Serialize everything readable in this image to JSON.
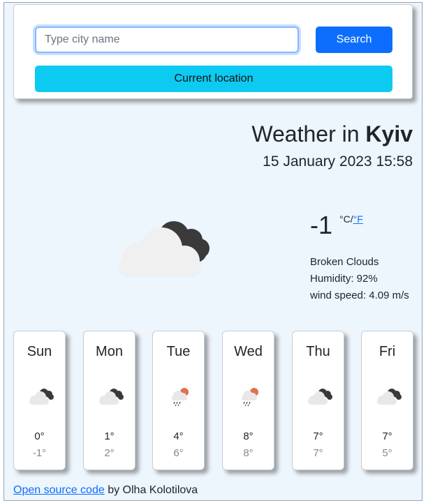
{
  "search": {
    "placeholder": "Type city name",
    "button_label": "Search",
    "location_label": "Current location"
  },
  "weather": {
    "title_prefix": "Weather in",
    "city": "Kyiv",
    "date": "15 January 2023 15:58",
    "temperature": "-1",
    "unit_celsius": "°C",
    "unit_separator": "/",
    "unit_fahrenheit": "°F",
    "description": "Broken Clouds",
    "humidity": "Humidity: 92%",
    "wind": "wind speed: 4.09 m/s",
    "icon": "broken-clouds-icon"
  },
  "forecast": [
    {
      "day": "Sun",
      "max": "0°",
      "min": "-1°",
      "icon": "broken-clouds-icon"
    },
    {
      "day": "Mon",
      "max": "1°",
      "min": "2°",
      "icon": "broken-clouds-icon"
    },
    {
      "day": "Tue",
      "max": "4°",
      "min": "6°",
      "icon": "rain-sun-icon"
    },
    {
      "day": "Wed",
      "max": "8°",
      "min": "8°",
      "icon": "rain-sun-icon"
    },
    {
      "day": "Thu",
      "max": "7°",
      "min": "7°",
      "icon": "broken-clouds-icon"
    },
    {
      "day": "Fri",
      "max": "7°",
      "min": "5°",
      "icon": "broken-clouds-icon"
    }
  ],
  "footer": {
    "link_label": "Open source code",
    "author": "by Olha Kolotilova"
  },
  "colors": {
    "primary": "#0d6efd",
    "info": "#0dcaf0",
    "background": "#edf5fd"
  }
}
